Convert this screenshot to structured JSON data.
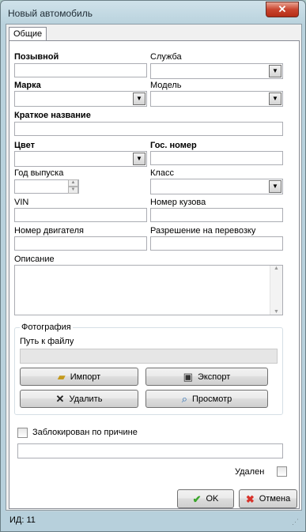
{
  "window": {
    "title": "Новый автомобиль",
    "close_symbol": "✕"
  },
  "tabs": [
    {
      "label": "Общие"
    }
  ],
  "form": {
    "callsign": {
      "label": "Позывной",
      "value": ""
    },
    "service": {
      "label": "Служба",
      "value": ""
    },
    "brand": {
      "label": "Марка",
      "value": ""
    },
    "model": {
      "label": "Модель",
      "value": ""
    },
    "short_name": {
      "label": "Краткое название",
      "value": ""
    },
    "color": {
      "label": "Цвет",
      "value": ""
    },
    "plate_number": {
      "label": "Гос. номер",
      "value": ""
    },
    "year": {
      "label": "Год выпуска",
      "value": ""
    },
    "class": {
      "label": "Класс",
      "value": ""
    },
    "vin": {
      "label": "VIN",
      "value": ""
    },
    "body_number": {
      "label": "Номер кузова",
      "value": ""
    },
    "engine_number": {
      "label": "Номер двигателя",
      "value": ""
    },
    "transport_permit": {
      "label": "Разрешение на перевозку",
      "value": ""
    },
    "description": {
      "label": "Описание",
      "value": ""
    }
  },
  "photo": {
    "group_label": "Фотография",
    "path_label": "Путь к файлу",
    "path_value": "",
    "import_label": "Импорт",
    "export_label": "Экспорт",
    "delete_label": "Удалить",
    "view_label": "Просмотр"
  },
  "blocked": {
    "label": "Заблокирован по причине",
    "checked": false,
    "reason": ""
  },
  "deleted": {
    "label": "Удален",
    "checked": false
  },
  "buttons": {
    "ok": "OK",
    "cancel": "Отмена"
  },
  "status": {
    "id_text": "ИД: 11"
  },
  "icons": [
    "close-icon",
    "dropdown-arrow-icon",
    "spin-up-icon",
    "spin-down-icon",
    "folder-open-icon",
    "save-disk-icon",
    "delete-x-icon",
    "magnifier-icon",
    "check-icon",
    "cancel-x-icon",
    "resize-grip-icon"
  ],
  "colors": {
    "accent_close": "#c9452f",
    "ok_check": "#3aa52a",
    "cancel_x": "#d8322a"
  }
}
